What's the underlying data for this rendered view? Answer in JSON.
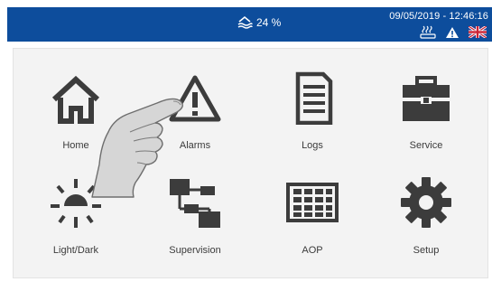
{
  "status": {
    "level_text": "24 %",
    "datetime": "09/05/2019 - 12:46:16",
    "icons": [
      "steam-cup-icon",
      "warning-icon",
      "uk-flag-icon"
    ]
  },
  "menu": {
    "items": [
      {
        "label": "Home",
        "icon": "house-icon"
      },
      {
        "label": "Alarms",
        "icon": "warning-triangle-icon"
      },
      {
        "label": "Logs",
        "icon": "document-icon"
      },
      {
        "label": "Service",
        "icon": "toolbox-icon"
      },
      {
        "label": "Light/Dark",
        "icon": "sun-icon"
      },
      {
        "label": "Supervision",
        "icon": "network-icon"
      },
      {
        "label": "AOP",
        "icon": "grid-panel-icon"
      },
      {
        "label": "Setup",
        "icon": "gear-icon"
      }
    ]
  },
  "colors": {
    "topbar": "#0d4d9c",
    "icon": "#3c3c3c",
    "panel": "#f3f3f3"
  }
}
